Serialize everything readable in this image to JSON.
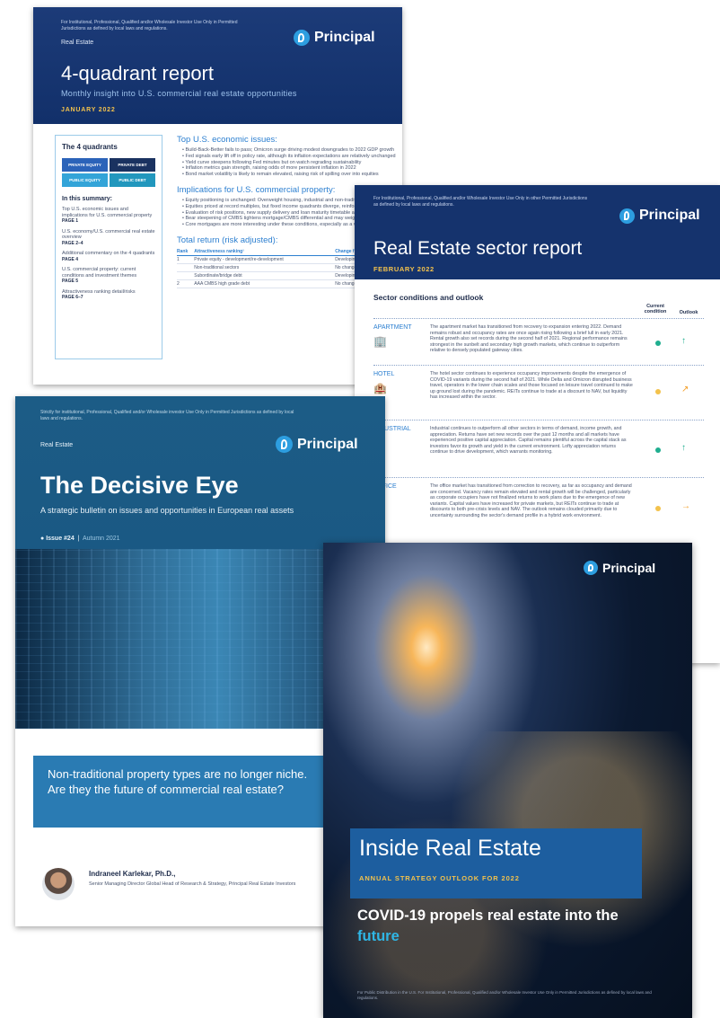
{
  "quadrant_report": {
    "disclaimer": "For Institutional, Professional, Qualified and/or Wholesale Investor Use Only in Permitted Jurisdictions as defined by local laws and regulations.",
    "section": "Real Estate",
    "logo": "Principal",
    "title": "4-quadrant report",
    "subtitle": "Monthly insight into U.S. commercial real estate opportunities",
    "date": "JANUARY 2022",
    "quadrants_title": "The 4 quadrants",
    "quadrants": [
      "PRIVATE EQUITY",
      "PRIVATE DEBT",
      "PUBLIC EQUITY",
      "PUBLIC DEBT"
    ],
    "summary_title": "In this summary:",
    "summary": [
      {
        "text": "Top U.S. economic issues and implications for U.S. commercial property",
        "page": "PAGE 1"
      },
      {
        "text": "U.S. economy/U.S. commercial real estate overview",
        "page": "PAGE 2–4"
      },
      {
        "text": "Additional commentary on the 4 quadrants",
        "page": "PAGE 4"
      },
      {
        "text": "U.S. commercial property: current conditions and investment themes",
        "page": "PAGE 5"
      },
      {
        "text": "Attractiveness ranking detail/risks",
        "page": "PAGE 6–7"
      }
    ],
    "issues_title": "Top U.S. economic issues:",
    "issues": [
      "Build-Back-Better fails to pass; Omicron surge driving modest downgrades to 2022 GDP growth",
      "Fed signals early lift off in policy rate, although its inflation expectations are relatively unchanged",
      "Yield curve steepens following Fed minutes but on watch regrading sustainability",
      "Inflation metrics gain strength, raising odds of more persistent inflation in 2022",
      "Bond market volatility is likely to remain elevated, raising risk of spilling over into equities"
    ],
    "implications_title": "Implications for U.S. commercial property:",
    "implications": [
      "Equity positioning is unchanged: Overweight housing, industrial and non-traditional sectors",
      "Equities priced at record multiples, but fixed income quadrants diverge, reinforcing caution",
      "Evaluation of risk positions, new supply delivery and loan maturity timetable appears prudent",
      "Bear steepening of CMBS tightens mortgage/CMBS differential and may weigh on conduits",
      "Core mortgages are more interesting under these conditions, especially as a volatility hedge"
    ],
    "return_title": "Total return (risk adjusted):",
    "table_headers": [
      "Rank",
      "Attractiveness ranking¹",
      "Change from prior"
    ],
    "table_rows": [
      [
        "1",
        "Private equity - development/re-development",
        "Developing"
      ],
      [
        "",
        "Non-traditional sectors",
        "No change"
      ],
      [
        "",
        "Subordinate/bridge debt",
        "Developing"
      ],
      [
        "2",
        "AAA CMBS high grade debt",
        "No change"
      ]
    ]
  },
  "sector_report": {
    "disclaimer": "For Institutional, Professional, Qualified and/or Wholesale Investor Use Only in other Permitted Jurisdictions as defined by local laws and regulations.",
    "logo": "Principal",
    "title": "Real Estate sector report",
    "date": "FEBRUARY 2022",
    "section_title": "Sector conditions and outlook",
    "col_current": "Current condition",
    "col_outlook": "Outlook",
    "rows": [
      {
        "label": "APARTMENT",
        "icon": "apartment-icon",
        "glyph": "🏢",
        "text": "The apartment market has transitioned from recovery to expansion entering 2022. Demand remains robust and occupancy rates are once again rising following a brief lull in early 2021. Rental growth also set records during the second half of 2021. Regional performance remains strongest in the sunbelt and secondary high growth markets, which continue to outperform relative to densely populated gateway cities.",
        "condition_color": "#1fae8f",
        "outlook_arrow": "↑",
        "outlook_color": "#1fae8f"
      },
      {
        "label": "HOTEL",
        "icon": "hotel-icon",
        "glyph": "🏨",
        "text": "The hotel sector continues to experience occupancy improvements despite the emergence of COVID-19 variants during the second half of 2021. While Delta and Omicron disrupted business travel, operators in the lower chain scales and those focused on leisure travel continued to make up ground lost during the pandemic. REITs continue to trade at a discount to NAV, but liquidity has increased within the sector.",
        "condition_color": "#f3c24c",
        "outlook_arrow": "↗",
        "outlook_color": "#f3a12c"
      },
      {
        "label": "INDUSTRIAL",
        "icon": "industrial-icon",
        "glyph": "",
        "text": "Industrial continues to outperform all other sectors in terms of demand, income growth, and appreciation. Returns have set new records over the past 12 months and all markets have experienced positive capital appreciation. Capital remains plentiful across the capital stack as investors favor its growth and yield in the current environment. Lofty appreciation returns continue to drive development, which warrants monitoring.",
        "condition_color": "#1fae8f",
        "outlook_arrow": "↑",
        "outlook_color": "#1fae8f"
      },
      {
        "label": "OFFICE",
        "icon": "office-icon",
        "glyph": "",
        "text": "The office market has transitioned from correction to recovery, as far as occupancy and demand are concerned. Vacancy rates remain elevated and rental growth will be challenged, particularly as corporate occupiers have not finalized returns to work plans due to the emergence of new variants. Capital values have increased for private markets, but REITs continue to trade at discounts to both pre-crisis levels and NAV. The outlook remains clouded primarily due to uncertainty surrounding the sector's demand profile in a hybrid work environment.",
        "condition_color": "#f3c24c",
        "outlook_arrow": "→",
        "outlook_color": "#f3a12c"
      }
    ]
  },
  "decisive_eye": {
    "disclaimer": "Strictly for institutional, Professional, Qualified and/or Wholesale investor Use Only in Permitted Jurisdictions as defined by local laws and regulations.",
    "section": "Real Estate",
    "logo": "Principal",
    "title": "The Decisive Eye",
    "subtitle": "A strategic bulletin on issues and opportunities in European real assets",
    "issue": "Issue #24",
    "season": "Autumn 2021",
    "banner": "Non-traditional property types are no longer niche. Are they the future of commercial real estate?",
    "author_name": "Indraneel Karlekar, Ph.D.,",
    "author_role": "Senior Managing Director Global Head of Research & Strategy, Principal Real Estate Investors"
  },
  "inside_real_estate": {
    "logo": "Principal",
    "title": "Inside Real Estate",
    "subtitle": "ANNUAL STRATEGY OUTLOOK FOR 2022",
    "headline_a": "COVID-19 propels real estate into the ",
    "headline_b": "future",
    "footer": "For Public Distribution in the U.S. For Institutional, Professional, Qualified and/or Wholesale Investor Use Only in Permitted Jurisdictions as defined by local laws and regulations."
  }
}
